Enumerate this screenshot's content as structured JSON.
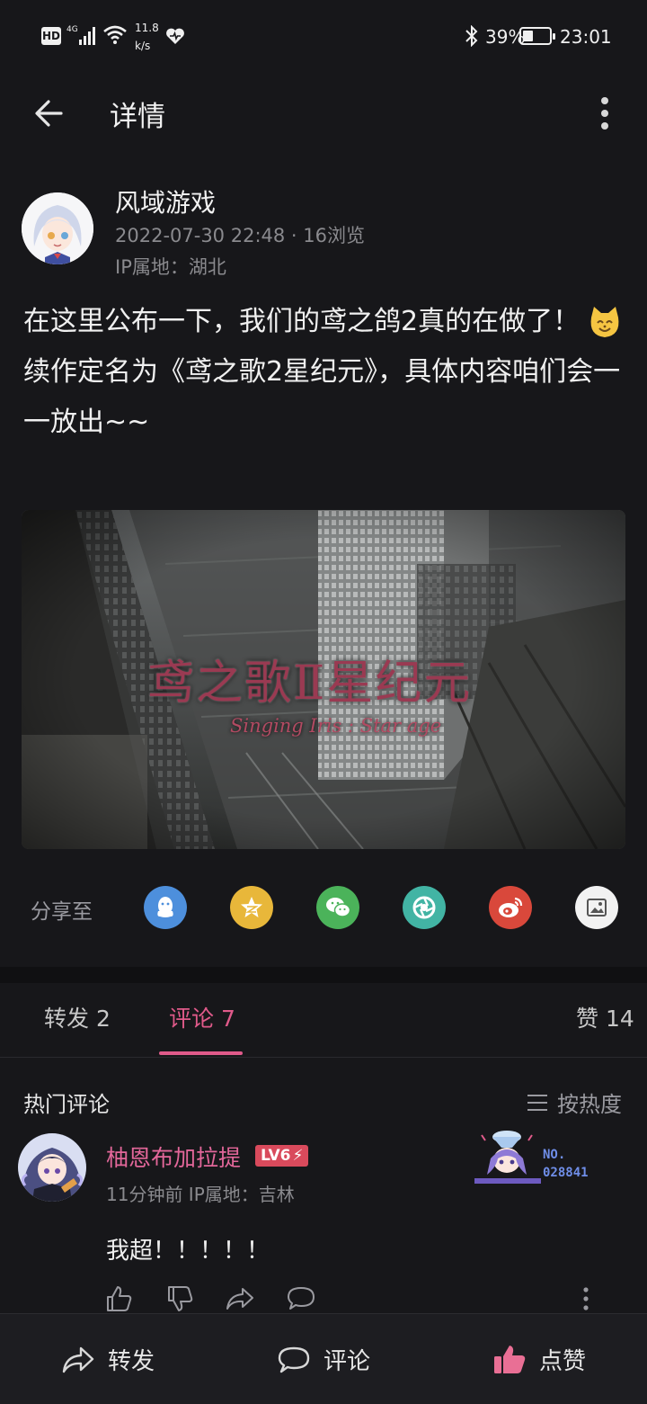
{
  "status_bar": {
    "network": "HD",
    "signal": "4G",
    "speed_value": "11.8",
    "speed_unit": "k/s",
    "battery": "39%",
    "battery_level": 0.39,
    "time": "23:01"
  },
  "header": {
    "title": "详情"
  },
  "post": {
    "author": "风域游戏",
    "meta": "2022-07-30 22:48 · 16浏览",
    "ip": "IP属地：湖北",
    "line1": "在这里公布一下，我们的鸢之鸽2真的在做了！",
    "line2": "续作定名为《鸢之歌2星纪元》，具体内容咱们会一一放出~~",
    "image_title": "鸢之歌Ⅱ星纪元",
    "image_subtitle": "Singing Iris : Star age"
  },
  "share": {
    "label": "分享至",
    "targets": [
      "qq-icon",
      "qzone-icon",
      "wechat-icon",
      "moments-icon",
      "weibo-icon",
      "save-image-icon"
    ]
  },
  "tabs": {
    "repost": "转发 2",
    "comments": "评论 7",
    "likes": "赞 14",
    "active": "comments"
  },
  "comments": {
    "hot_label": "热门评论",
    "sort_label": "按热度",
    "items": [
      {
        "name": "柚恩布加拉提",
        "level": "LV6",
        "meta": "11分钟前  IP属地：吉林",
        "text": "我超！！！！！",
        "badge_label": "NO.",
        "badge_number": "028841"
      }
    ]
  },
  "bottom_bar": {
    "repost": "转发",
    "comment": "评论",
    "like": "点赞"
  },
  "colors": {
    "background": "#17171a",
    "accent_pink": "#e05a8a",
    "name_pink": "#e3679a",
    "like_pink": "#e96f95"
  }
}
